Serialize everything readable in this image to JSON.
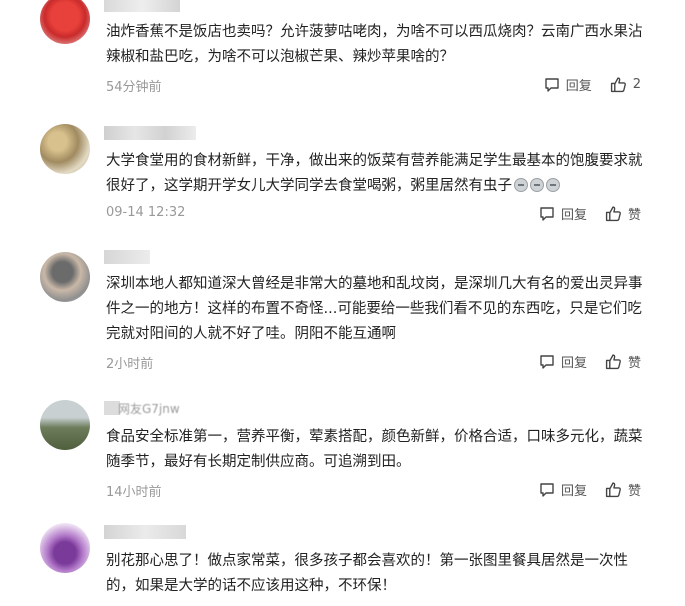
{
  "comments": [
    {
      "text": "油炸香蕉不是饭店也卖吗？允许菠萝咕咾肉，为啥不可以西瓜烧肉？云南广西水果沾辣椒和盐巴吃，为啥不可以泡椒芒果、辣炒苹果啥的？",
      "time": "54分钟前",
      "reply_label": "回复",
      "like_label": "2"
    },
    {
      "text": "大学食堂用的食材新鲜，干净，做出来的饭菜有营养能满足学生最基本的饱腹要求就很好了，这学期开学女儿大学同学去食堂喝粥，粥里居然有虫子",
      "time": "09-14 12:32",
      "reply_label": "回复",
      "like_label": "赞"
    },
    {
      "text": "深圳本地人都知道深大曾经是非常大的墓地和乱坟岗，是深圳几大有名的爱出灵异事件之一的地方！这样的布置不奇怪...可能要给一些我们看不见的东西吃，只是它们吃完就对阳间的人就不好了哇。阴阳不能互通啊",
      "time": "2小时前",
      "reply_label": "回复",
      "like_label": "赞"
    },
    {
      "name": "网友G7jnw",
      "text": "食品安全标准第一，营养平衡，荤素搭配，颜色新鲜，价格合适，口味多元化，蔬菜随季节，最好有长期定制供应商。可追溯到田。",
      "time": "14小时前",
      "reply_label": "回复",
      "like_label": "赞"
    },
    {
      "text": "别花那心思了！做点家常菜，很多孩子都会喜欢的！第一张图里餐具居然是一次性的，如果是大学的话不应该用这种，不环保！"
    }
  ]
}
